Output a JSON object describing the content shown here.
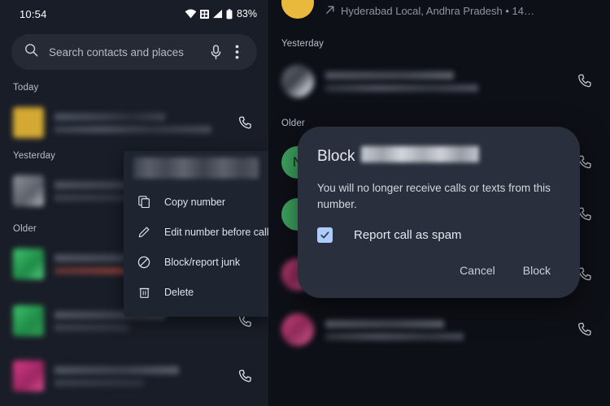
{
  "statusbar": {
    "time": "10:54",
    "battery_percent": "83%",
    "icons": [
      "wifi-icon",
      "vibrate-icon",
      "signal-icon",
      "battery-icon"
    ]
  },
  "search": {
    "placeholder": "Search contacts and places",
    "value": "",
    "search_icon": "search-icon",
    "mic_icon": "microphone-icon",
    "overflow_icon": "more-vert-icon"
  },
  "left_panel": {
    "sections": [
      {
        "label": "Today"
      },
      {
        "label": "Yesterday"
      },
      {
        "label": "Older"
      }
    ],
    "call_icon": "phone-handset-icon",
    "rows": [
      {
        "avatar_color": "#d4a933",
        "avatar_shape": "square",
        "redacted": true
      },
      {
        "avatar_color": "#8f949c",
        "avatar_shape": "square",
        "redacted": true
      },
      {
        "avatar_color": "#3ec46a",
        "avatar_shape": "square",
        "redacted": true
      },
      {
        "avatar_color": "#3ec46a",
        "avatar_shape": "square",
        "redacted": true
      },
      {
        "avatar_color": "#d6398a",
        "avatar_shape": "square",
        "redacted": true
      }
    ]
  },
  "context_menu": {
    "header_redacted": true,
    "items": [
      {
        "label": "Copy number",
        "icon": "copy-icon"
      },
      {
        "label": "Edit number before call",
        "icon": "pencil-icon"
      },
      {
        "label": "Block/report junk",
        "icon": "block-circle-icon"
      },
      {
        "label": "Delete",
        "icon": "trash-icon"
      }
    ]
  },
  "right_panel": {
    "top_entry": {
      "subtitle": "Hyderabad Local, Andhra Pradesh • 14…",
      "direction_icon": "outgoing-call-arrow-icon",
      "avatar_color": "#e8b93c"
    },
    "sections": [
      {
        "label": "Yesterday"
      },
      {
        "label": "Older"
      }
    ],
    "call_icon": "phone-handset-icon",
    "rows": [
      {
        "avatar_color": "#9aa0a8",
        "initial": "",
        "redacted": true
      },
      {
        "avatar_color": "#3ea45f",
        "initial": "N",
        "redacted": false
      },
      {
        "avatar_color": "#3ea45f",
        "initial": "",
        "redacted": false
      },
      {
        "avatar_color": "#c8447e",
        "initial": "",
        "redacted": true
      },
      {
        "avatar_color": "#c8447e",
        "initial": "",
        "redacted": true
      }
    ]
  },
  "dialog": {
    "title_prefix": "Block",
    "title_redacted_name": true,
    "body": "You will no longer receive calls or texts from this number.",
    "checkbox": {
      "label": "Report call as spam",
      "checked": true,
      "color": "#aecbfa"
    },
    "cancel_label": "Cancel",
    "confirm_label": "Block"
  },
  "colors": {
    "left_bg": "#191d27",
    "right_bg": "#0e1017",
    "dialog_bg": "#2a2f3d",
    "menu_bg": "#1f2431",
    "search_bg": "#252a35",
    "accent": "#aecbfa"
  }
}
